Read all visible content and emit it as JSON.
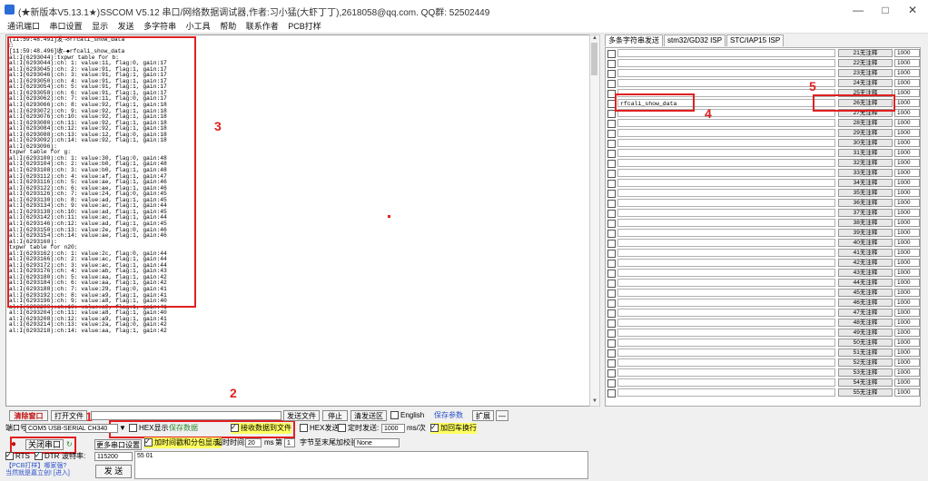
{
  "window": {
    "title": "(★新版本V5.13.1★)SSCOM V5.12 串口/网络数据调试器,作者:习小猛(大虾丁丁),2618058@qq.com. QQ群: 52502449",
    "minimize": "—",
    "maximize": "□",
    "close": "✕"
  },
  "menu": [
    "通讯端口",
    "串口设置",
    "显示",
    "发送",
    "多字符串",
    "小工具",
    "帮助",
    "联系作者",
    "PCB打样"
  ],
  "receive_log": "[11:59:48.491]发→◇rfcali_show_data\n□\n[11:59:48.496]收←◆rfcali_show_data\nal:I(6293044):txpwr table for b:\nal:I(6293044):ch: 1: value:11, flag:0, gain:17\nal:I(6293045):ch: 2: value:91, flag:1, gain:17\nal:I(6293046):ch: 3: value:91, flag:1, gain:17\nal:I(6293050):ch: 4: value:91, flag:1, gain:17\nal:I(6293054):ch: 5: value:91, flag:1, gain:17\nal:I(6293058):ch: 6: value:91, flag:1, gain:17\nal:I(6293062):ch: 7: value:11, flag:0, gain:17\nal:I(6293066):ch: 8: value:92, flag:1, gain:18\nal:I(6293072):ch: 9: value:92, flag:1, gain:18\nal:I(6293076):ch:10: value:92, flag:1, gain:18\nal:I(6293080):ch:11: value:92, flag:1, gain:18\nal:I(6293084):ch:12: value:92, flag:1, gain:18\nal:I(6293088):ch:13: value:12, flag:0, gain:18\nal:I(6293092):ch:14: value:92, flag:1, gain:18\nal:I(6293096):\ntxpwr table for g:\nal:I(6293100):ch: 1: value:30, flag:0, gain:48\nal:I(6293104):ch: 2: value:b0, flag:1, gain:48\nal:I(6293108):ch: 3: value:b0, flag:1, gain:48\nal:I(6293112):ch: 4: value:af, flag:1, gain:47\nal:I(6293116):ch: 5: value:ae, flag:1, gain:46\nal:I(6293122):ch: 6: value:ae, flag:1, gain:46\nal:I(6293126):ch: 7: value:24, flag:0, gain:45\nal:I(6293130):ch: 8: value:ad, flag:1, gain:45\nal:I(6293134):ch: 9: value:ac, flag:1, gain:44\nal:I(6293138):ch:10: value:ad, flag:1, gain:45\nal:I(6293142):ch:11: value:ac, flag:1, gain:44\nal:I(6293146):ch:12: value:ad, flag:1, gain:45\nal:I(6293150):ch:13: value:2e, flag:0, gain:46\nal:I(6293154):ch:14: value:ae, flag:1, gain:46\nal:I(6293160):\ntxpwr table for n20:\nal:I(6293162):ch: 1: value:2c, flag:0, gain:44\nal:I(6293166):ch: 2: value:ac, flag:1, gain:44\nal:I(6293172):ch: 3: value:ac, flag:1, gain:44\nal:I(6293176):ch: 4: value:ab, flag:1, gain:43\nal:I(6293180):ch: 5: value:aa, flag:1, gain:42\nal:I(6293184):ch: 6: value:aa, flag:1, gain:42\nal:I(6293188):ch: 7: value:29, flag:0, gain:41\nal:I(6293192):ch: 8: value:a9, flag:1, gain:41\nal:I(6293196):ch: 9: value:a8, flag:1, gain:40\nal:I(6293200):ch:10: value:a9, flag:1, gain:41\nal:I(6293204):ch:11: value:a8, flag:1, gain:40\nal:I(6293208):ch:12: value:a9, flag:1, gain:41\nal:I(6293214):ch:13: value:2a, flag:0, gain:42\nal:I(6293218):ch:14: value:aa, flag:1, gain:42",
  "right_panel": {
    "tabs": [
      "多条字符串发送",
      "stm32/GD32 ISP",
      "STC/IAP15 ISP"
    ],
    "rows": [
      {
        "cmd": "",
        "btn": "21无注释",
        "num": "1000"
      },
      {
        "cmd": "",
        "btn": "22无注释",
        "num": "1000"
      },
      {
        "cmd": "",
        "btn": "23无注释",
        "num": "1000"
      },
      {
        "cmd": "",
        "btn": "24无注释",
        "num": "1000"
      },
      {
        "cmd": "",
        "btn": "25无注释",
        "num": "1000"
      },
      {
        "cmd": "rfcali_show_data",
        "btn": "26无注释",
        "num": "1000"
      },
      {
        "cmd": "",
        "btn": "27无注释",
        "num": "1000"
      },
      {
        "cmd": "",
        "btn": "28无注释",
        "num": "1000"
      },
      {
        "cmd": "",
        "btn": "29无注释",
        "num": "1000"
      },
      {
        "cmd": "",
        "btn": "30无注释",
        "num": "1000"
      },
      {
        "cmd": "",
        "btn": "31无注释",
        "num": "1000"
      },
      {
        "cmd": "",
        "btn": "32无注释",
        "num": "1000"
      },
      {
        "cmd": "",
        "btn": "33无注释",
        "num": "1000"
      },
      {
        "cmd": "",
        "btn": "34无注释",
        "num": "1000"
      },
      {
        "cmd": "",
        "btn": "35无注释",
        "num": "1000"
      },
      {
        "cmd": "",
        "btn": "36无注释",
        "num": "1000"
      },
      {
        "cmd": "",
        "btn": "37无注释",
        "num": "1000"
      },
      {
        "cmd": "",
        "btn": "38无注释",
        "num": "1000"
      },
      {
        "cmd": "",
        "btn": "39无注释",
        "num": "1000"
      },
      {
        "cmd": "",
        "btn": "40无注释",
        "num": "1000"
      },
      {
        "cmd": "",
        "btn": "41无注释",
        "num": "1000"
      },
      {
        "cmd": "",
        "btn": "42无注释",
        "num": "1000"
      },
      {
        "cmd": "",
        "btn": "43无注释",
        "num": "1000"
      },
      {
        "cmd": "",
        "btn": "44无注释",
        "num": "1000"
      },
      {
        "cmd": "",
        "btn": "45无注释",
        "num": "1000"
      },
      {
        "cmd": "",
        "btn": "46无注释",
        "num": "1000"
      },
      {
        "cmd": "",
        "btn": "47无注释",
        "num": "1000"
      },
      {
        "cmd": "",
        "btn": "48无注释",
        "num": "1000"
      },
      {
        "cmd": "",
        "btn": "49无注释",
        "num": "1000"
      },
      {
        "cmd": "",
        "btn": "50无注释",
        "num": "1000"
      },
      {
        "cmd": "",
        "btn": "51无注释",
        "num": "1000"
      },
      {
        "cmd": "",
        "btn": "52无注释",
        "num": "1000"
      },
      {
        "cmd": "",
        "btn": "53无注释",
        "num": "1000"
      },
      {
        "cmd": "",
        "btn": "54无注释",
        "num": "1000"
      },
      {
        "cmd": "",
        "btn": "55无注释",
        "num": "1000"
      }
    ]
  },
  "annotations": {
    "n1": "1",
    "n2": "2",
    "n3": "3",
    "n4": "4",
    "n5": "5",
    "color": "#e02020"
  },
  "controls": {
    "clear_window": "清除窗口",
    "open_file": "打开文件",
    "send_file": "发送文件",
    "stop": "停止",
    "clear_send": "清发送区",
    "english": "English",
    "save_params": "保存参数",
    "expand": "扩展",
    "collapse": "—",
    "port_label": "端口号",
    "port_value": "COM5 USB-SERIAL CH340",
    "hex_display": "HEX显示",
    "save_data": "保存数据",
    "recv_to_file": "接收数据到文件",
    "hex_send": "HEX发送",
    "timed_send": "定时发送:",
    "interval": "1000",
    "interval_unit": "ms/次",
    "add_newline": "加回车换行",
    "close_port": "关闭串口",
    "more_settings": "更多串口设置",
    "timestamp_label": "加时间戳和分包显示,",
    "timeout_label": "超时时间:",
    "timeout_value": "20",
    "ms_label": "ms",
    "nth_label": "第",
    "nth_value": "1",
    "byte_label": "字节至末尾加校验",
    "check_value": "None",
    "rts": "RTS",
    "dtr": "DTR",
    "baud_label": "波特率:",
    "baud_value": "115200",
    "send_text": "55 01",
    "send_btn": "发 送",
    "promo_line1": "【PCB打样】哪家强?",
    "promo_line2": "当然就是嘉立创! [进入]"
  }
}
